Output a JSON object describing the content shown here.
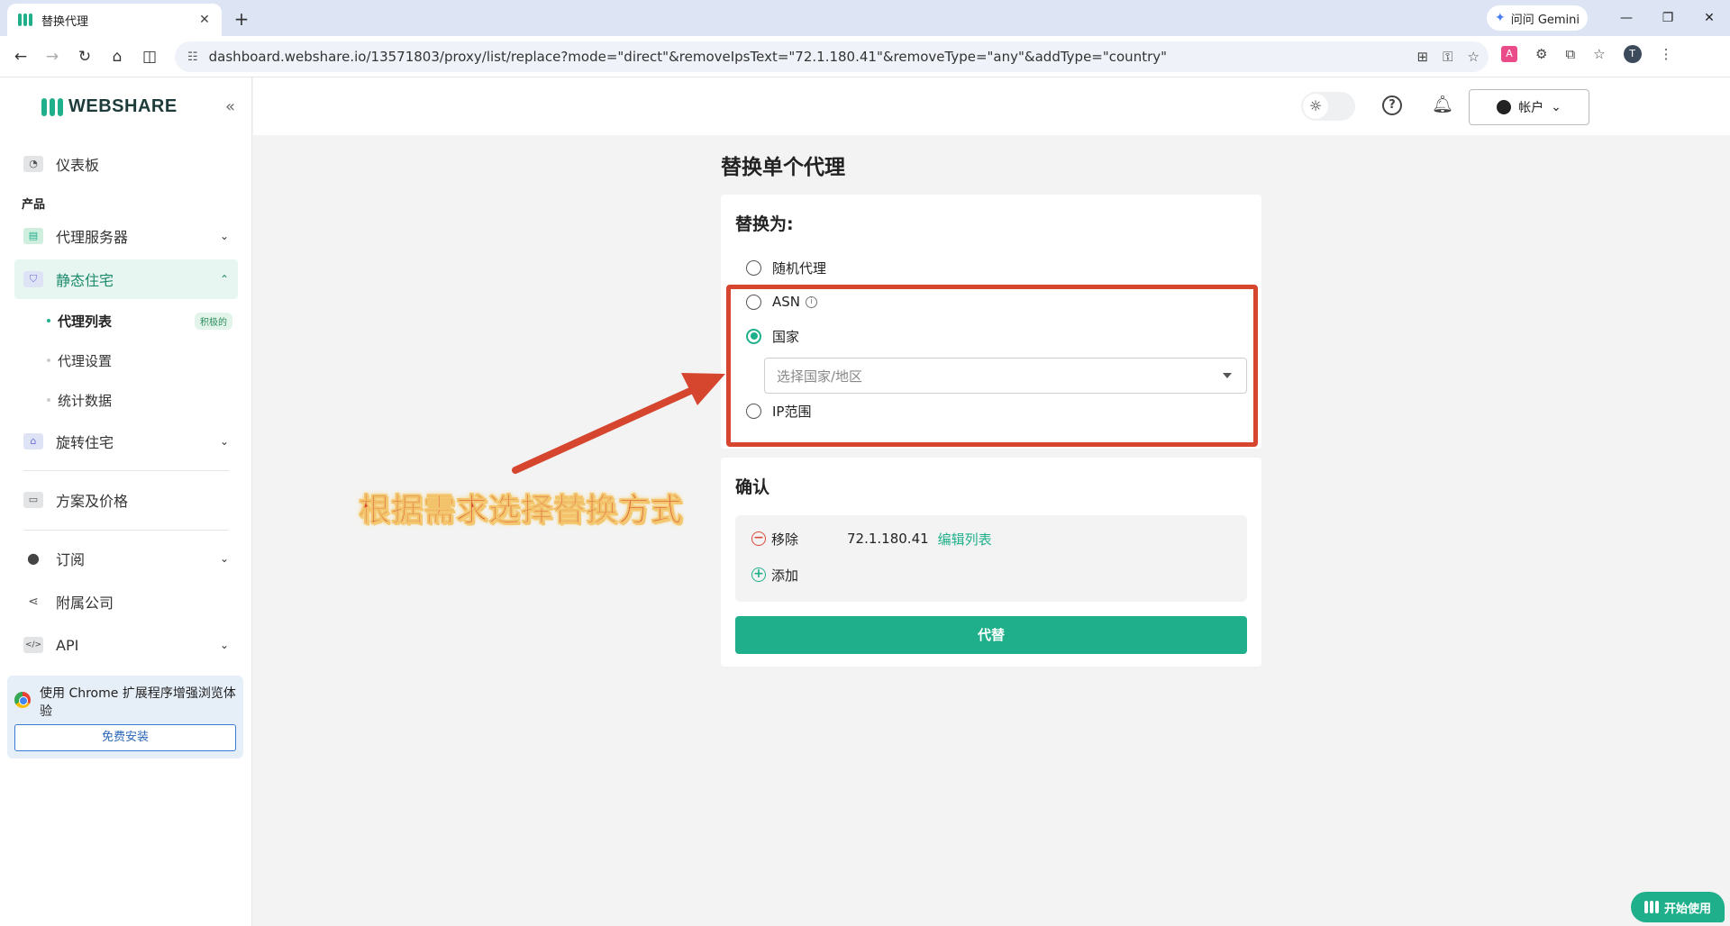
{
  "browser": {
    "tab_title": "替换代理",
    "gemini_label": "问问 Gemini",
    "url": "dashboard.webshare.io/13571803/proxy/list/replace?mode=\"direct\"&removeIpsText=\"72.1.180.41\"&removeType=\"any\"&addType=\"country\"",
    "profile_initial": "T"
  },
  "sidebar": {
    "logo_text": "WEBSHARE",
    "dashboard": "仪表板",
    "section_products": "产品",
    "proxy_servers": "代理服务器",
    "static_residential": "静态住宅",
    "sub_items": [
      {
        "label": "代理列表",
        "badge": "积极的"
      },
      {
        "label": "代理设置"
      },
      {
        "label": "统计数据"
      }
    ],
    "rotating_residential": "旋转住宅",
    "plans_pricing": "方案及价格",
    "subscription": "订阅",
    "affiliates": "附属公司",
    "api": "API",
    "promo_text": "使用 Chrome 扩展程序增强浏览体验",
    "promo_button": "免费安装"
  },
  "header": {
    "account_label": "帐户"
  },
  "main": {
    "page_title": "替换单个代理",
    "replace_with": {
      "title": "替换为:",
      "options": [
        {
          "label": "随机代理",
          "checked": false
        },
        {
          "label": "ASN",
          "checked": false
        },
        {
          "label": "国家",
          "checked": true
        },
        {
          "label": "IP范围",
          "checked": false
        }
      ],
      "country_placeholder": "选择国家/地区"
    },
    "confirm": {
      "title": "确认",
      "remove_label": "移除",
      "remove_ip": "72.1.180.41",
      "edit_list_link": "编辑列表",
      "add_label": "添加",
      "replace_button": "代替"
    }
  },
  "annotation": {
    "text": "根据需求选择替换方式",
    "color": "#d6452e"
  },
  "floating": {
    "start_button": "开始使用"
  },
  "colors": {
    "accent": "#1fb08b",
    "annotation": "#d6452e"
  }
}
